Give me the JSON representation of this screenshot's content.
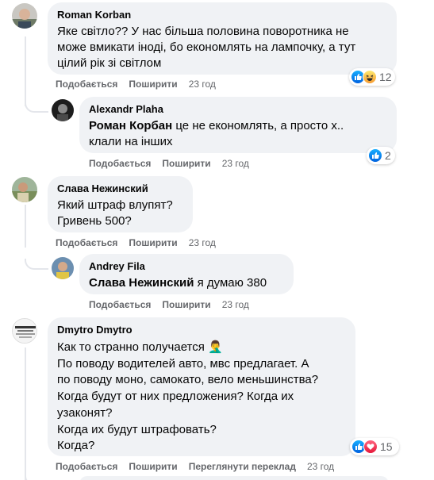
{
  "comments": [
    {
      "author": "Roman Korban",
      "text": "Яке світло?? У нас більша половина поворотника не\nможе вмикати іноді, бо економлять на лампочку, а тут\nцілий рік зі світлом",
      "like": "Подобається",
      "share": "Поширити",
      "time": "23 год",
      "reaction_count": "12"
    },
    {
      "author": "Alexandr Plaha",
      "mention": "Роман Корбан",
      "text_line1": " це не економлять, а просто х..",
      "text_line2": "клали на інших",
      "like": "Подобається",
      "share": "Поширити",
      "time": "23 год",
      "reaction_count": "2"
    },
    {
      "author": "Слава Нежинский",
      "text": "Який штраф влупят?\nГривень 500?",
      "like": "Подобається",
      "share": "Поширити",
      "time": "23 год"
    },
    {
      "author": "Andrey Fila",
      "mention": "Слава Нежинский",
      "text": " я думаю 380",
      "like": "Подобається",
      "share": "Поширити",
      "time": "23 год"
    },
    {
      "author": "Dmytro Dmytro",
      "text": "Как то странно получается 🤦‍♂️\nПо поводу водителей авто, мвс предлагает. А\nпо поводу моно, самокато, вело меньшинства?\nКогда будут от них предложения? Когда их\nузаконят?\nКогда их будут штрафовать?\nКогда?",
      "like": "Подобається",
      "share": "Поширити",
      "translate": "Переглянути переклад",
      "time": "23 год",
      "reaction_count": "15",
      "avatar_text": "ПО ТВОЄМУ"
    }
  ],
  "colors": {
    "bubble": "#f0f2f5",
    "meta": "#65676b",
    "like_blue": "#1877f2"
  }
}
